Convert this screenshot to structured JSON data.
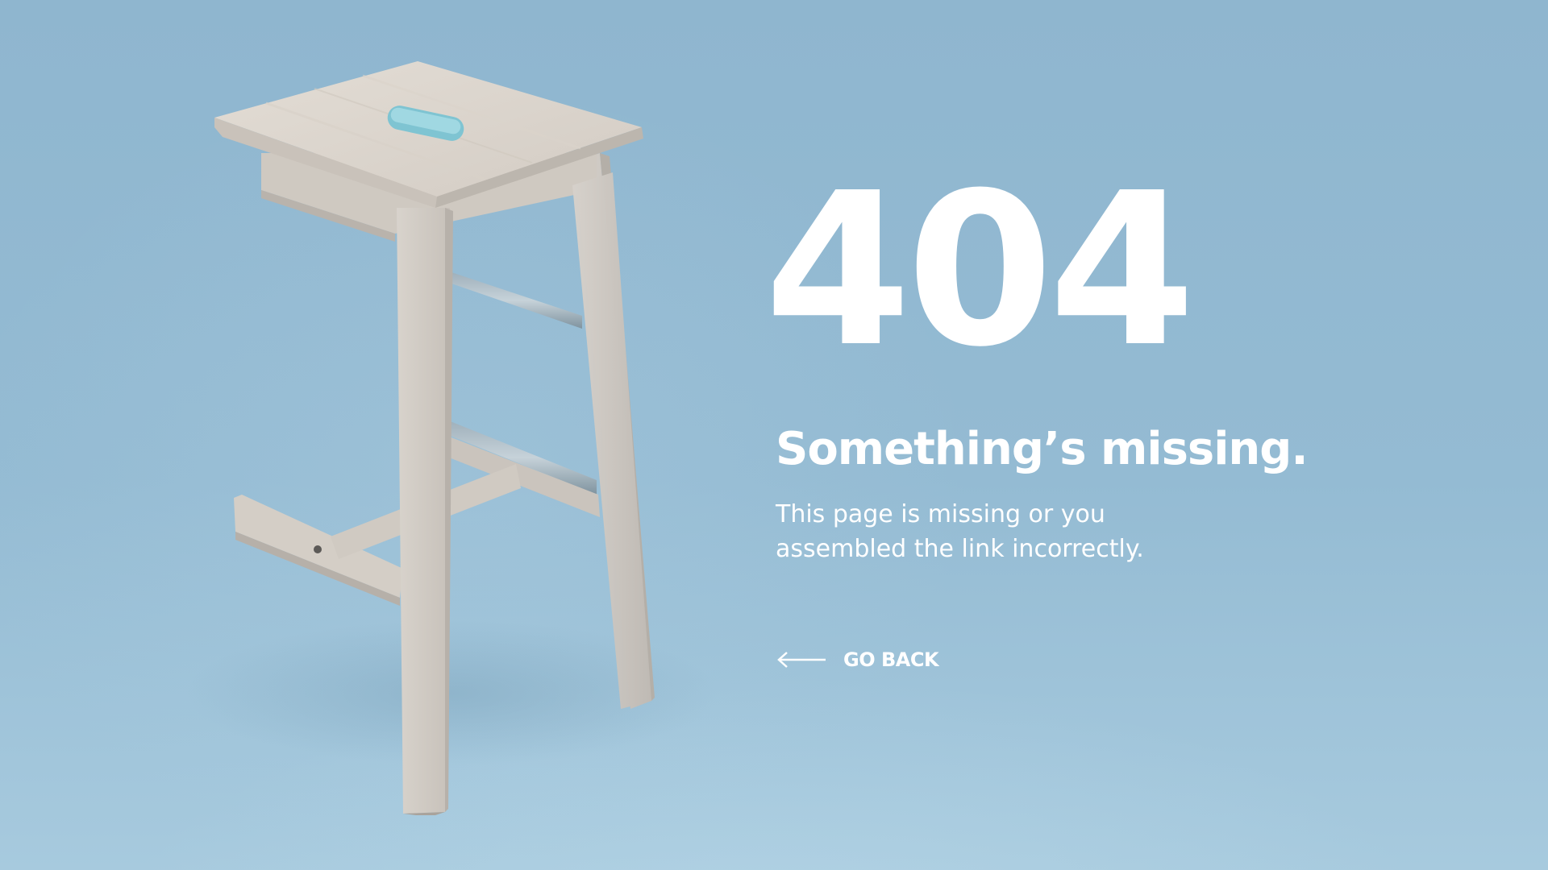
{
  "error": {
    "code": "404",
    "headline": "Something’s missing.",
    "description_lines": [
      "This page is missing or you",
      "assembled the link incorrectly."
    ]
  },
  "navigation": {
    "back_label": "GO BACK",
    "back_icon": "arrow-left-icon"
  },
  "illustration": {
    "subject": "wooden-stool-image"
  },
  "colors": {
    "background": "#92b9d1",
    "text": "#ffffff",
    "wood": "#cfc9c2"
  }
}
